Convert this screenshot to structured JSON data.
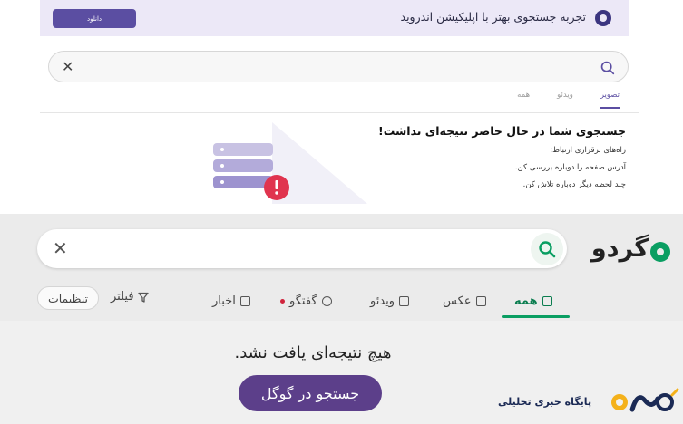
{
  "top": {
    "banner": {
      "text": "تجربه جستجوی بهتر با اپلیکیشن اندروید",
      "button_label": "دانلود"
    },
    "tabs": [
      {
        "label": "همه",
        "active": false
      },
      {
        "label": "ویدئو",
        "active": false
      },
      {
        "label": "تصویر",
        "active": true
      }
    ],
    "error": {
      "title": "جستجوی شما در حال حاضر نتیجه‌ای نداشت!",
      "lines": [
        "راه‌های برقراری ارتباط:",
        "آدرس صفحه را دوباره بررسی کن.",
        "چند لحظه دیگر دوباره تلاش کن."
      ]
    }
  },
  "bottom": {
    "brand": {
      "name": "گردو"
    },
    "tabs": [
      {
        "label": "همه",
        "icon": "all-icon",
        "active": true
      },
      {
        "label": "عکس",
        "icon": "image-icon",
        "active": false
      },
      {
        "label": "ویدئو",
        "icon": "video-icon",
        "active": false
      },
      {
        "label": "گفتگو",
        "icon": "chat-icon",
        "active": false
      },
      {
        "label": "اخبار",
        "icon": "news-icon",
        "active": false
      }
    ],
    "filter_label": "فیلتر",
    "settings_label": "تنظیمات",
    "no_result": "هیچ نتیجه‌ای یافت نشد.",
    "google_button": "جستجو در گوگل"
  },
  "watermark": {
    "tagline": "پایگاه خبری تحلیلی",
    "logo_text": "روزنو"
  },
  "colors": {
    "purple": "#5b4ea2",
    "green": "#0a9e62",
    "google_button": "#5c3f8a",
    "alert_red": "#e0344f"
  }
}
